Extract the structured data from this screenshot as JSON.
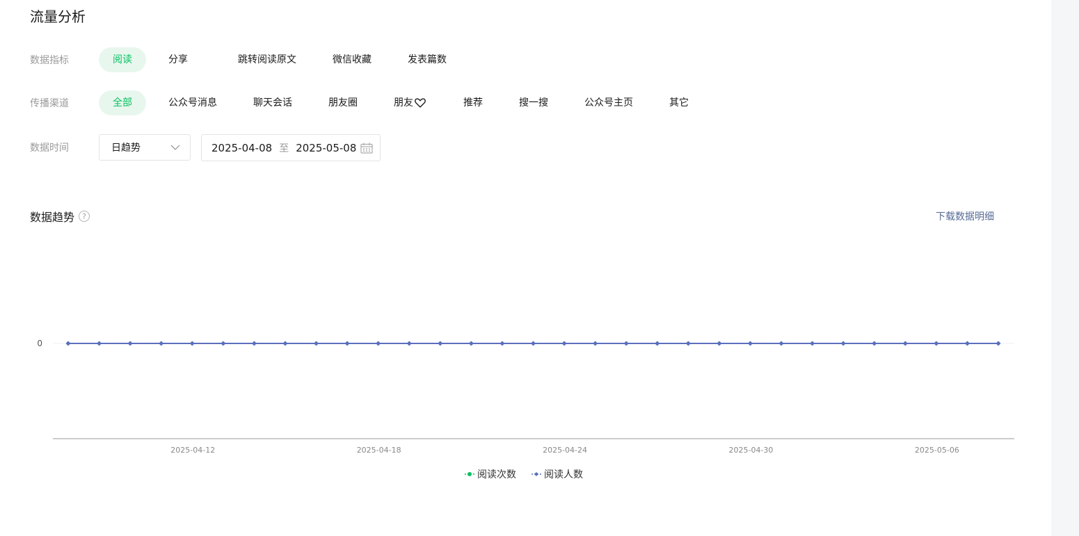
{
  "page_title": "流量分析",
  "filters": {
    "metric": {
      "label": "数据指标",
      "options": [
        "阅读",
        "分享",
        "跳转阅读原文",
        "微信收藏",
        "发表篇数"
      ],
      "selected": 0
    },
    "channel": {
      "label": "传播渠道",
      "options": [
        "全部",
        "公众号消息",
        "聊天会话",
        "朋友圈",
        "朋友",
        "推荐",
        "搜一搜",
        "公众号主页",
        "其它"
      ],
      "selected": 0
    },
    "time": {
      "label": "数据时间",
      "granularity": "日趋势",
      "start": "2025-04-08",
      "separator": "至",
      "end": "2025-05-08"
    }
  },
  "section": {
    "title": "数据趋势",
    "help_icon": "?",
    "download": "下载数据明细"
  },
  "icons": {
    "heart": "heart-icon",
    "chevron": "chevron-down-icon",
    "calendar": "calendar-icon",
    "help": "help-icon"
  },
  "colors": {
    "accent": "#07c160",
    "accent_bg": "#e8f7ee",
    "series_read_count": "#07c160",
    "series_read_users": "#5b6fbd",
    "link": "#576b95"
  },
  "chart_data": {
    "type": "line",
    "x": [
      "2025-04-08",
      "2025-04-09",
      "2025-04-10",
      "2025-04-11",
      "2025-04-12",
      "2025-04-13",
      "2025-04-14",
      "2025-04-15",
      "2025-04-16",
      "2025-04-17",
      "2025-04-18",
      "2025-04-19",
      "2025-04-20",
      "2025-04-21",
      "2025-04-22",
      "2025-04-23",
      "2025-04-24",
      "2025-04-25",
      "2025-04-26",
      "2025-04-27",
      "2025-04-28",
      "2025-04-29",
      "2025-04-30",
      "2025-05-01",
      "2025-05-02",
      "2025-05-03",
      "2025-05-04",
      "2025-05-05",
      "2025-05-06",
      "2025-05-07",
      "2025-05-08"
    ],
    "x_ticks": [
      "2025-04-12",
      "2025-04-18",
      "2025-04-24",
      "2025-04-30",
      "2025-05-06"
    ],
    "y_ticks": [
      0
    ],
    "series": [
      {
        "name": "阅读次数",
        "values": [
          0,
          0,
          0,
          0,
          0,
          0,
          0,
          0,
          0,
          0,
          0,
          0,
          0,
          0,
          0,
          0,
          0,
          0,
          0,
          0,
          0,
          0,
          0,
          0,
          0,
          0,
          0,
          0,
          0,
          0,
          0
        ]
      },
      {
        "name": "阅读人数",
        "values": [
          0,
          0,
          0,
          0,
          0,
          0,
          0,
          0,
          0,
          0,
          0,
          0,
          0,
          0,
          0,
          0,
          0,
          0,
          0,
          0,
          0,
          0,
          0,
          0,
          0,
          0,
          0,
          0,
          0,
          0,
          0
        ]
      }
    ],
    "grid": true,
    "legend": "bottom"
  }
}
